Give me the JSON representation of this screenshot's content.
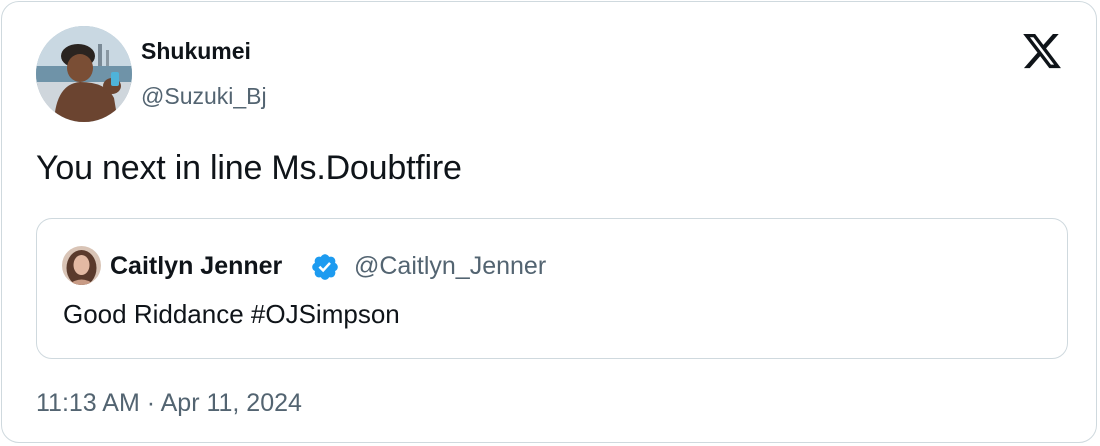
{
  "tweet": {
    "author": {
      "display_name": "Shukumei",
      "handle": "@Suzuki_Bj"
    },
    "text": "You next in line Ms.Doubtfire",
    "timestamp": "11:13 AM · Apr 11, 2024",
    "brand_icon": "x-logo-icon"
  },
  "quoted_tweet": {
    "author": {
      "display_name": "Caitlyn Jenner",
      "handle": "@Caitlyn_Jenner",
      "verified": true
    },
    "text": "Good Riddance #OJSimpson"
  },
  "colors": {
    "primary_text": "#0f1419",
    "secondary_text": "#536471",
    "border": "#cfd9de",
    "verified_blue": "#1d9bf0"
  }
}
